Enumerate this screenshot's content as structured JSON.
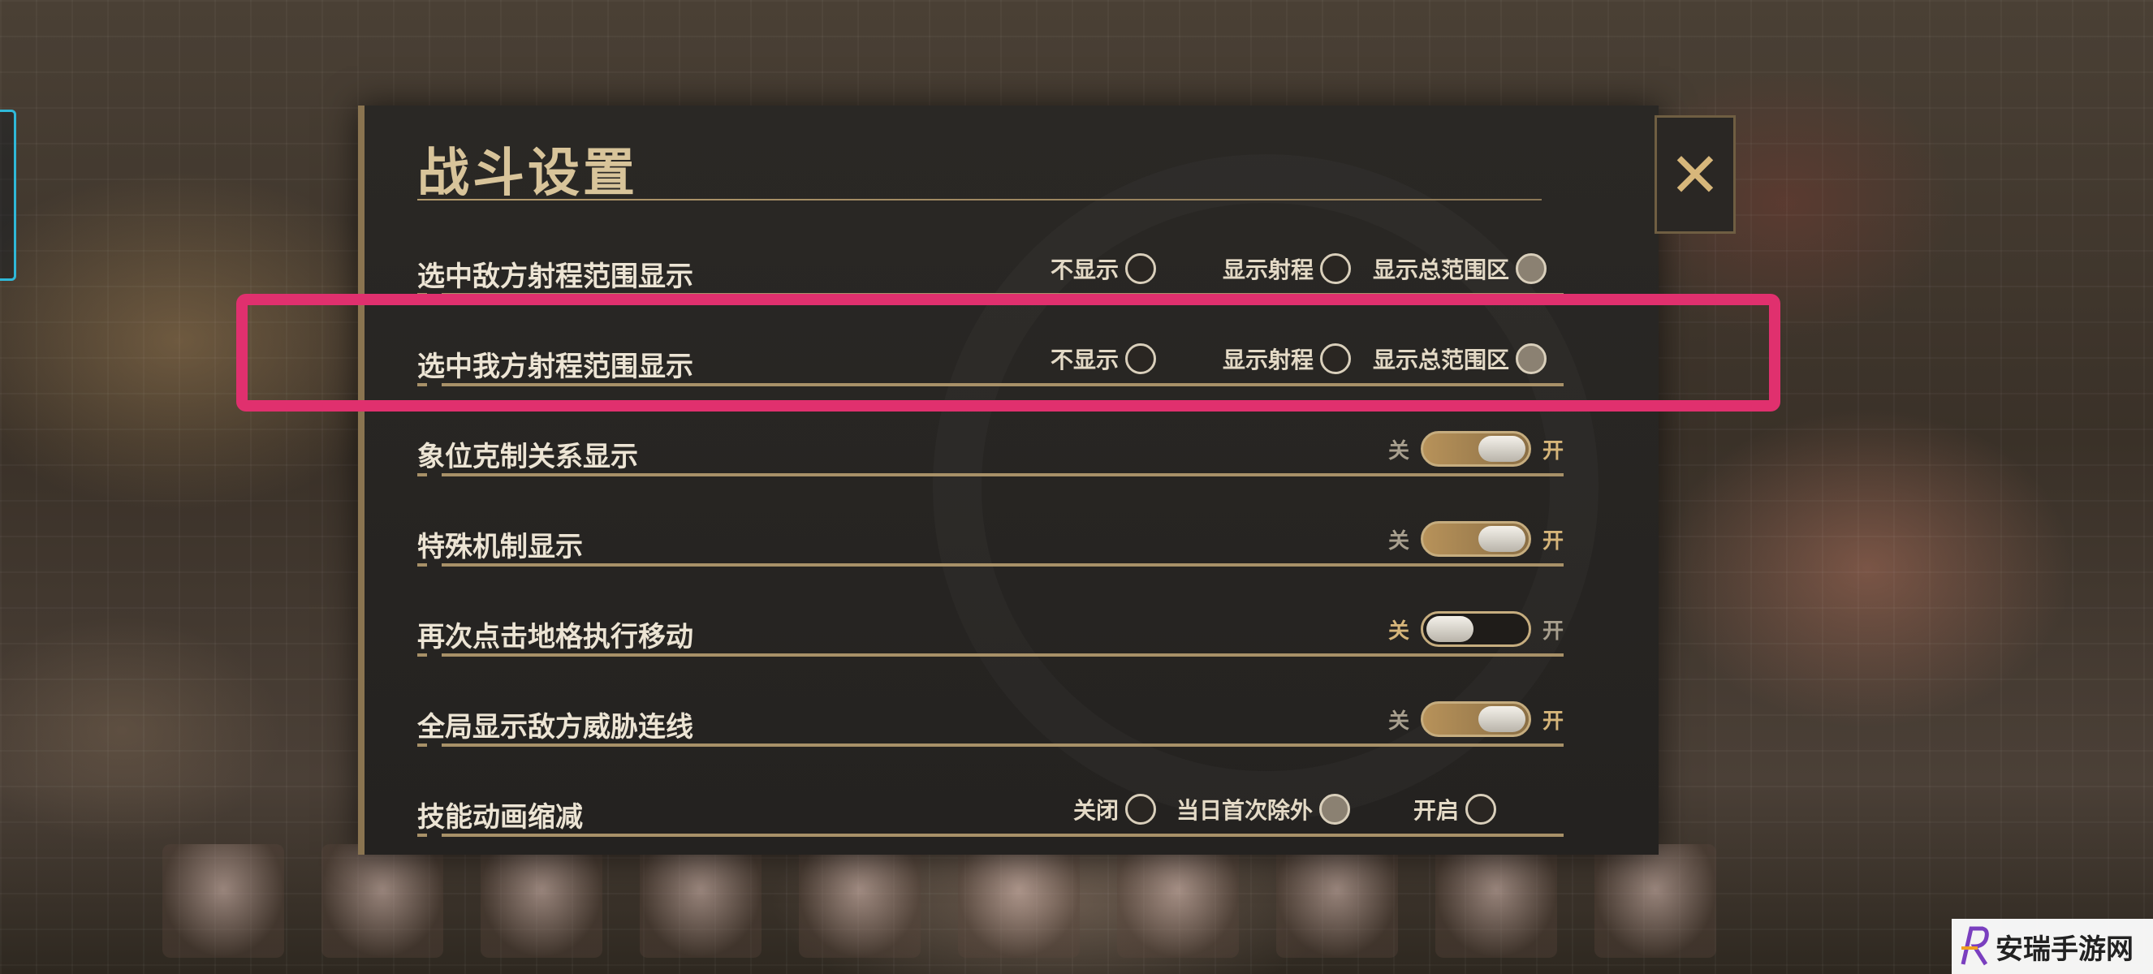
{
  "dialog": {
    "title": "战斗设置",
    "rows": [
      {
        "label": "选中敌方射程范围显示",
        "type": "radio",
        "options": [
          {
            "label": "不显示",
            "selected": false
          },
          {
            "label": "显示射程",
            "selected": false
          },
          {
            "label": "显示总范围区",
            "selected": true
          }
        ]
      },
      {
        "label": "选中我方射程范围显示",
        "type": "radio",
        "options": [
          {
            "label": "不显示",
            "selected": false
          },
          {
            "label": "显示射程",
            "selected": false
          },
          {
            "label": "显示总范围区",
            "selected": true
          }
        ]
      },
      {
        "label": "象位克制关系显示",
        "type": "toggle",
        "off_label": "关",
        "on_label": "开",
        "state": "on"
      },
      {
        "label": "特殊机制显示",
        "type": "toggle",
        "off_label": "关",
        "on_label": "开",
        "state": "on"
      },
      {
        "label": "再次点击地格执行移动",
        "type": "toggle",
        "off_label": "关",
        "on_label": "开",
        "state": "off"
      },
      {
        "label": "全局显示敌方威胁连线",
        "type": "toggle",
        "off_label": "关",
        "on_label": "开",
        "state": "on"
      },
      {
        "label": "技能动画缩减",
        "type": "radio",
        "options": [
          {
            "label": "关闭",
            "selected": false
          },
          {
            "label": "当日首次除外",
            "selected": true
          },
          {
            "label": "开启",
            "selected": false
          }
        ]
      }
    ]
  },
  "close_icon": "close-x-icon",
  "highlight_color": "#e0306e",
  "accent_color": "#b7925a",
  "watermark": {
    "text": "安瑞手游网"
  }
}
